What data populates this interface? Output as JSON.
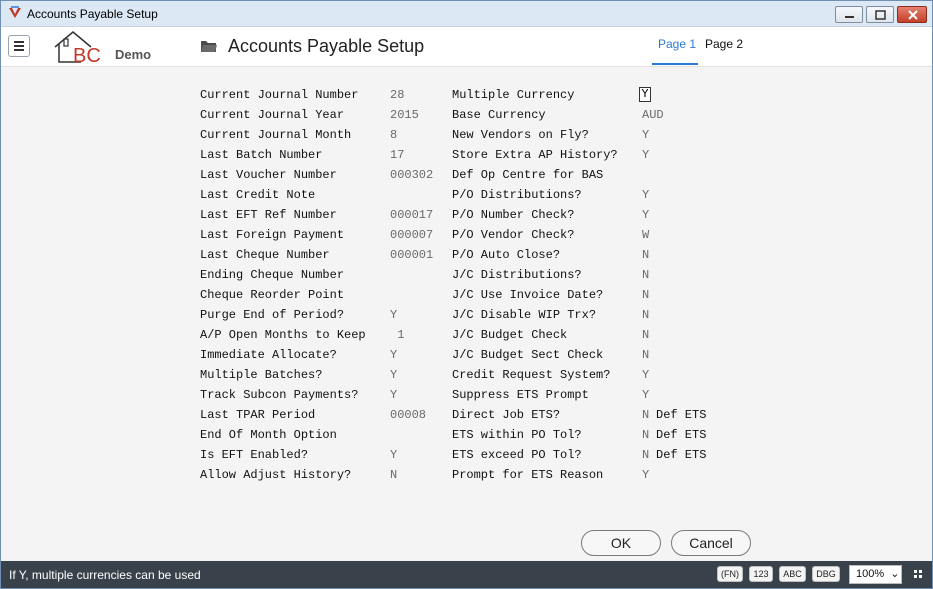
{
  "window": {
    "title": "Accounts Payable Setup"
  },
  "header": {
    "logo_text": "BC",
    "logo_sub": "Demo",
    "page_title": "Accounts Payable Setup",
    "tabs": [
      {
        "label": "Page 1"
      },
      {
        "label": "Page 2"
      }
    ]
  },
  "left_fields": [
    {
      "label": "Current Journal Number",
      "value": "28"
    },
    {
      "label": "Current Journal Year",
      "value": "2015"
    },
    {
      "label": "Current Journal Month",
      "value": "8"
    },
    {
      "label": "Last Batch Number",
      "value": "17"
    },
    {
      "label": "Last Voucher Number",
      "value": "000302"
    },
    {
      "label": "Last Credit Note",
      "value": ""
    },
    {
      "label": "Last EFT Ref Number",
      "value": "000017"
    },
    {
      "label": "Last Foreign Payment",
      "value": "000007"
    },
    {
      "label": "Last Cheque Number",
      "value": "000001"
    },
    {
      "label": "Ending Cheque Number",
      "value": ""
    },
    {
      "label": "Cheque Reorder Point",
      "value": ""
    },
    {
      "label": "Purge End of Period?",
      "value": "Y"
    },
    {
      "label": "A/P Open Months to Keep",
      "value": " 1"
    },
    {
      "label": "Immediate Allocate?",
      "value": "Y"
    },
    {
      "label": "Multiple Batches?",
      "value": "Y"
    },
    {
      "label": "Track Subcon Payments?",
      "value": "Y"
    },
    {
      "label": "Last TPAR Period",
      "value": "00008"
    },
    {
      "label": "End Of Month Option",
      "value": ""
    },
    {
      "label": "Is EFT Enabled?",
      "value": "Y"
    },
    {
      "label": "Allow Adjust History?",
      "value": "N"
    }
  ],
  "right_fields": [
    {
      "label": "Multiple Currency",
      "value": "Y",
      "extra": ""
    },
    {
      "label": "Base Currency",
      "value": "AUD",
      "extra": ""
    },
    {
      "label": "New Vendors on Fly?",
      "value": "Y",
      "extra": ""
    },
    {
      "label": "Store Extra AP History?",
      "value": "Y",
      "extra": ""
    },
    {
      "label": "Def Op Centre for BAS",
      "value": "",
      "extra": ""
    },
    {
      "label": "P/O Distributions?",
      "value": "Y",
      "extra": ""
    },
    {
      "label": "P/O Number Check?",
      "value": "Y",
      "extra": ""
    },
    {
      "label": "P/O Vendor Check?",
      "value": "W",
      "extra": ""
    },
    {
      "label": "P/O Auto Close?",
      "value": "N",
      "extra": ""
    },
    {
      "label": "J/C Distributions?",
      "value": "N",
      "extra": ""
    },
    {
      "label": "J/C Use Invoice Date?",
      "value": "N",
      "extra": ""
    },
    {
      "label": "J/C Disable WIP Trx?",
      "value": "N",
      "extra": ""
    },
    {
      "label": "J/C Budget Check",
      "value": "N",
      "extra": ""
    },
    {
      "label": "J/C Budget Sect Check",
      "value": "N",
      "extra": ""
    },
    {
      "label": "Credit Request System?",
      "value": "Y",
      "extra": ""
    },
    {
      "label": "Suppress ETS Prompt",
      "value": "Y",
      "extra": ""
    },
    {
      "label": "Direct Job ETS?",
      "value": "N",
      "extra": "Def ETS"
    },
    {
      "label": "ETS within PO Tol?",
      "value": "N",
      "extra": "Def ETS"
    },
    {
      "label": "ETS exceed PO Tol?",
      "value": "N",
      "extra": "Def ETS"
    },
    {
      "label": "Prompt for ETS Reason",
      "value": "Y",
      "extra": ""
    }
  ],
  "buttons": {
    "ok": "OK",
    "cancel": "Cancel"
  },
  "status": {
    "message": "If Y, multiple currencies can be used",
    "chips": [
      "(FN)",
      "123",
      "ABC",
      "DBG"
    ],
    "zoom": "100%",
    "zoom_chevron": "⌄"
  },
  "colors": {
    "accent": "#2b7bd5",
    "status_bg": "#39424a",
    "logo_red": "#c0392b"
  }
}
